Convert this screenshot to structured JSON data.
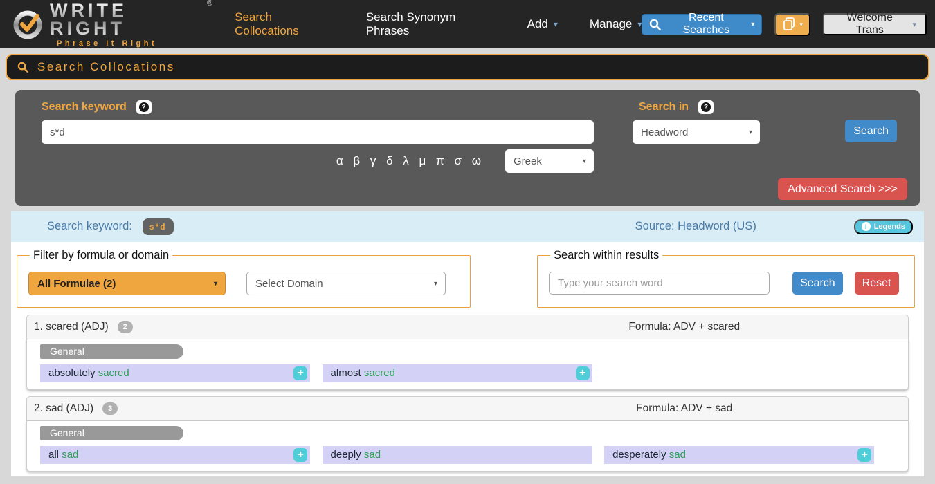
{
  "navbar": {
    "brand": "WRITE RIGHT",
    "registered": "®",
    "tagline": "Phrase It Right",
    "links": [
      {
        "label": "Search Collocations",
        "active": true,
        "caret": false
      },
      {
        "label": "Search Synonym Phrases",
        "active": false,
        "caret": false
      },
      {
        "label": "Add",
        "active": false,
        "caret": true
      },
      {
        "label": "Manage",
        "active": false,
        "caret": true
      }
    ],
    "recent_searches_label": "Recent Searches",
    "welcome_label": "Welcome Trans"
  },
  "title_bar": {
    "title": "Search Collocations"
  },
  "search_panel": {
    "keyword_label": "Search keyword",
    "keyword_value": "s*d",
    "greek_letters": "α β γ δ λ μ π σ ω",
    "greek_select_value": "Greek",
    "search_in_label": "Search in",
    "search_in_value": "Headword",
    "search_button": "Search",
    "advanced_button": "Advanced Search >>>"
  },
  "summary_bar": {
    "keyword_label": "Search keyword:",
    "keyword_badge": "s*d",
    "source_text": "Source: Headword (US)",
    "legends_label": "Legends"
  },
  "filters": {
    "formula_legend": "Filter by formula or domain",
    "formula_select_value": "All Formulae (2)",
    "domain_select_value": "Select Domain",
    "within_legend": "Search within results",
    "within_placeholder": "Type your search word",
    "search_button": "Search",
    "reset_button": "Reset"
  },
  "results": [
    {
      "title": "1. scared (ADJ)",
      "count": "2",
      "formula": "Formula: ADV + scared",
      "domain_tag": "General",
      "collocations": [
        {
          "pre": "absolutely",
          "head": "sacred"
        },
        {
          "pre": "almost",
          "head": "sacred"
        }
      ]
    },
    {
      "title": "2. sad (ADJ)",
      "count": "3",
      "formula": "Formula: ADV + sad",
      "domain_tag": "General",
      "collocations": [
        {
          "pre": "all",
          "head": "sad"
        },
        {
          "pre": "deeply",
          "head": "sad"
        },
        {
          "pre": "desperately",
          "head": "sad"
        }
      ]
    }
  ],
  "colors": {
    "accent_orange": "#f0a53f",
    "navbar_bg": "#252525",
    "panel_bg": "#595959",
    "primary_blue": "#428bca",
    "danger_red": "#d9534f",
    "info_cyan": "#56c5de",
    "summary_bg": "#d9edf7",
    "chip_bg": "#d4d1f6",
    "chip_headword_green": "#2f9e5a",
    "domain_tag_gray": "#999999"
  }
}
